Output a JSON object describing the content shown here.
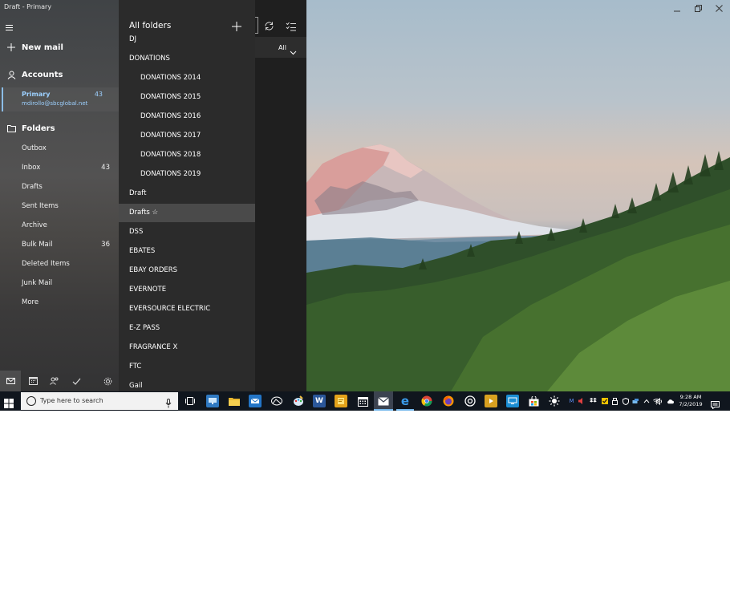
{
  "window": {
    "title": "Draft - Primary"
  },
  "nav": {
    "new_mail": "New mail",
    "accounts": "Accounts",
    "account": {
      "name": "Primary",
      "email": "mdirollo@sbcglobal.net",
      "count": "43"
    },
    "folders_heading": "Folders",
    "folders": [
      {
        "label": "Outbox",
        "count": ""
      },
      {
        "label": "Inbox",
        "count": "43"
      },
      {
        "label": "Drafts",
        "count": ""
      },
      {
        "label": "Sent Items",
        "count": ""
      },
      {
        "label": "Archive",
        "count": ""
      },
      {
        "label": "Bulk Mail",
        "count": "36"
      },
      {
        "label": "Deleted Items",
        "count": ""
      },
      {
        "label": "Junk Mail",
        "count": ""
      },
      {
        "label": "More",
        "count": ""
      }
    ],
    "bottom_icons": [
      "mail-icon",
      "calendar-icon",
      "people-icon",
      "todo-icon",
      "settings-icon"
    ]
  },
  "all_folders": {
    "title": "All folders",
    "items": [
      {
        "label": "DJ",
        "indent": 0
      },
      {
        "label": "DONATIONS",
        "indent": 0
      },
      {
        "label": "DONATIONS 2014",
        "indent": 1
      },
      {
        "label": "DONATIONS 2015",
        "indent": 1
      },
      {
        "label": "DONATIONS 2016",
        "indent": 1
      },
      {
        "label": "DONATIONS 2017",
        "indent": 1
      },
      {
        "label": "DONATIONS 2018",
        "indent": 1
      },
      {
        "label": "DONATIONS 2019",
        "indent": 1
      },
      {
        "label": "Draft",
        "indent": 0
      },
      {
        "label": "Drafts ☆",
        "indent": 0,
        "selected": true
      },
      {
        "label": "DSS",
        "indent": 0
      },
      {
        "label": "EBATES",
        "indent": 0
      },
      {
        "label": "EBAY ORDERS",
        "indent": 0
      },
      {
        "label": "EVERNOTE",
        "indent": 0
      },
      {
        "label": "EVERSOURCE ELECTRIC",
        "indent": 0
      },
      {
        "label": "E-Z PASS",
        "indent": 0
      },
      {
        "label": "FRAGRANCE X",
        "indent": 0
      },
      {
        "label": "FTC",
        "indent": 0
      },
      {
        "label": "Gail",
        "indent": 0
      }
    ]
  },
  "message_list": {
    "filter_label": "All"
  },
  "taskbar": {
    "search_placeholder": "Type here to search",
    "apps": [
      {
        "name": "task-view-icon",
        "glyph": "",
        "color": ""
      },
      {
        "name": "remote-desktop-icon",
        "glyph": "",
        "color": "#2f79c2"
      },
      {
        "name": "file-explorer-icon",
        "glyph": "",
        "color": "#e8b730"
      },
      {
        "name": "outlook-icon",
        "glyph": "",
        "color": "#2375c7"
      },
      {
        "name": "photos-icon",
        "glyph": "",
        "color": ""
      },
      {
        "name": "paint-icon",
        "glyph": "",
        "color": ""
      },
      {
        "name": "word-icon",
        "glyph": "W",
        "color": "#2b579a"
      },
      {
        "name": "sticky-notes-icon",
        "glyph": "",
        "color": "#e3a21a"
      },
      {
        "name": "calendar-icon",
        "glyph": "",
        "color": ""
      },
      {
        "name": "mail-icon",
        "glyph": "",
        "color": ""
      },
      {
        "name": "edge-icon",
        "glyph": "e",
        "color": ""
      },
      {
        "name": "chrome-icon",
        "glyph": "",
        "color": ""
      },
      {
        "name": "firefox-icon",
        "glyph": "",
        "color": ""
      },
      {
        "name": "groove-icon",
        "glyph": "",
        "color": ""
      },
      {
        "name": "video-icon",
        "glyph": "",
        "color": "#d8a020"
      },
      {
        "name": "connect-icon",
        "glyph": "",
        "color": "#1b8dd3"
      },
      {
        "name": "store-icon",
        "glyph": "",
        "color": "#2d7fd0"
      },
      {
        "name": "brightness-icon",
        "glyph": "",
        "color": ""
      }
    ],
    "clock_time": "9:28 AM",
    "clock_date": "7/2/2019"
  },
  "colors": {
    "accent": "#8cbde6",
    "taskbar": "#10161e",
    "flyout": "#2b2b2b",
    "selected_folder": "#4a4a4a"
  }
}
